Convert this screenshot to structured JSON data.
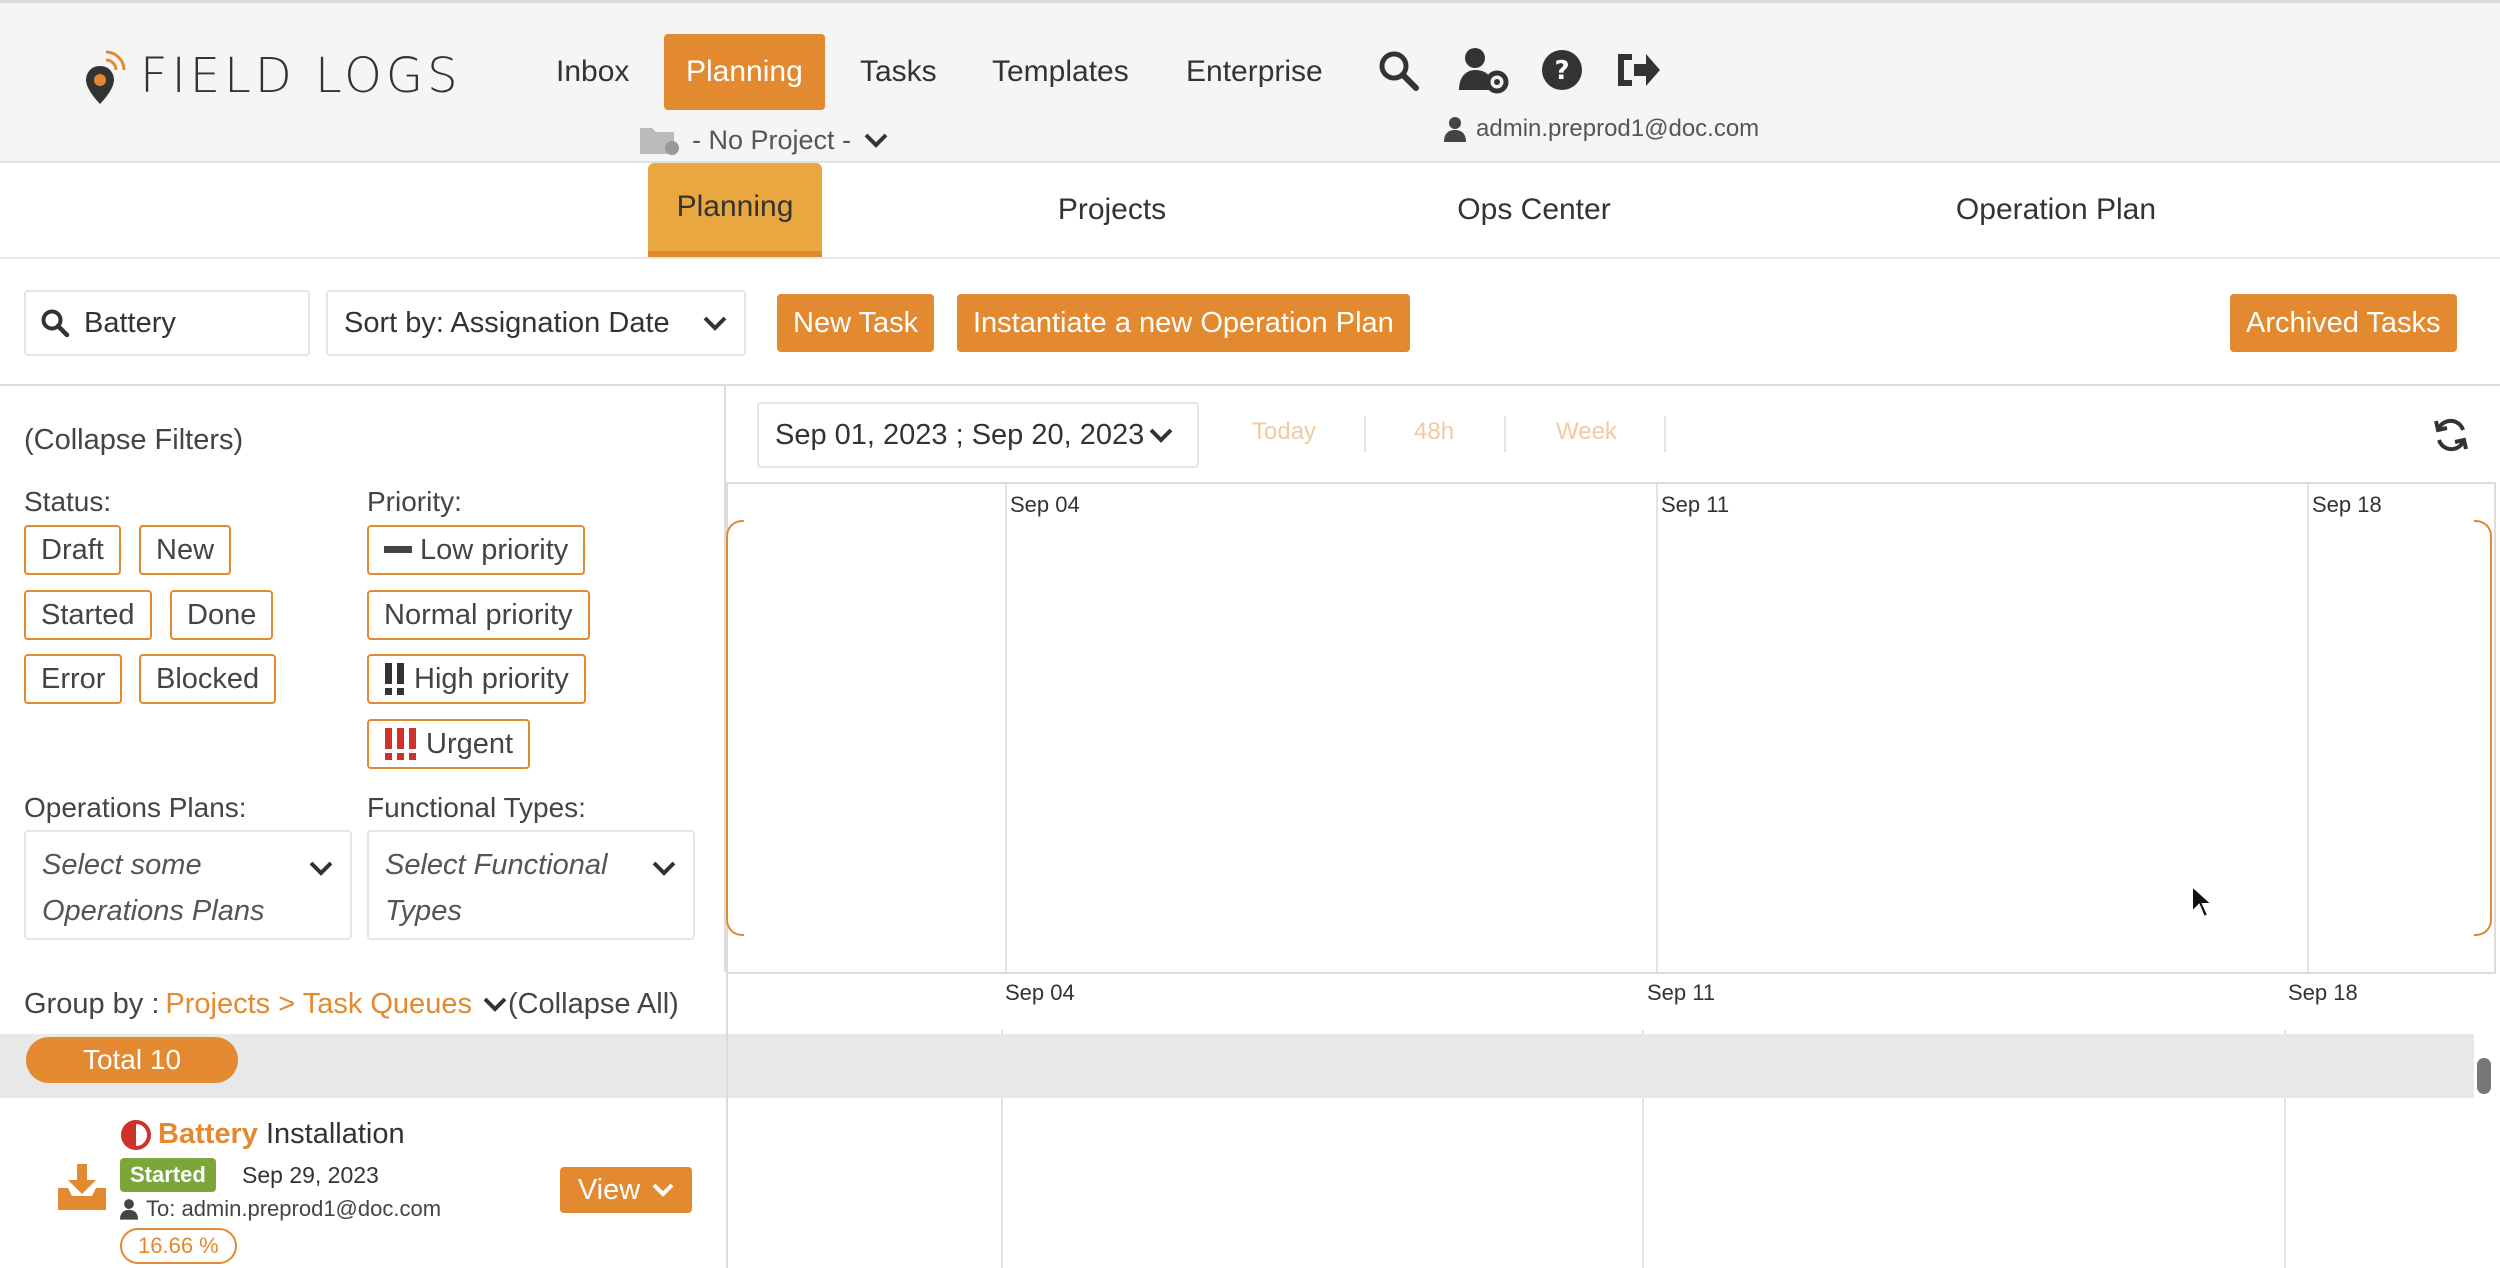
{
  "brand": {
    "logo_text": "FIELD LOGS"
  },
  "nav": {
    "items": [
      {
        "label": "Inbox"
      },
      {
        "label": "Planning"
      },
      {
        "label": "Tasks"
      },
      {
        "label": "Templates"
      },
      {
        "label": "Enterprise"
      }
    ],
    "icons": [
      "search-icon",
      "user-settings-icon",
      "help-icon",
      "logout-icon"
    ]
  },
  "project_select": {
    "label": "- No Project -"
  },
  "user": {
    "email": "admin.preprod1@doc.com"
  },
  "subtabs": [
    {
      "label": "Planning"
    },
    {
      "label": "Projects"
    },
    {
      "label": "Ops Center"
    },
    {
      "label": "Operation Plan"
    }
  ],
  "toolbar": {
    "search_value": "Battery",
    "sort_label": "Sort by: Assignation Date",
    "new_task_label": "New Task",
    "instantiate_label": "Instantiate a new Operation Plan",
    "archived_label": "Archived Tasks"
  },
  "filters": {
    "collapse_label": "(Collapse Filters)",
    "status_label": "Status:",
    "status_chips": [
      "Draft",
      "New",
      "Started",
      "Done",
      "Error",
      "Blocked"
    ],
    "priority_label": "Priority:",
    "priority_chips": [
      "Low priority",
      "Normal priority",
      "High priority",
      "Urgent"
    ],
    "ops_plans_label": "Operations Plans:",
    "ops_plans_placeholder": "Select some Operations Plans",
    "functional_types_label": "Functional Types:",
    "functional_types_placeholder": "Select Functional Types"
  },
  "timeline": {
    "date_range": "Sep 01, 2023 ; Sep 20, 2023",
    "quick": [
      "Today",
      "48h",
      "Week"
    ],
    "top_dates": [
      "Sep 04",
      "Sep 11",
      "Sep 18"
    ],
    "bottom_dates": [
      "Sep 04",
      "Sep 11",
      "Sep 18"
    ]
  },
  "groupby": {
    "label": "Group by : ",
    "value": "Projects > Task Queues",
    "collapse_all": "(Collapse All)"
  },
  "total": {
    "label": "Total 10"
  },
  "tasks": [
    {
      "title_highlight": "Battery",
      "title_rest": " Installation",
      "status": "Started",
      "date": "Sep 29, 2023",
      "assignee": "To: admin.preprod1@doc.com",
      "progress": "16.66 %",
      "view_label": "View"
    }
  ],
  "colors": {
    "accent": "#e3892f",
    "started": "#7aa63c",
    "urgent": "#d0312d"
  }
}
